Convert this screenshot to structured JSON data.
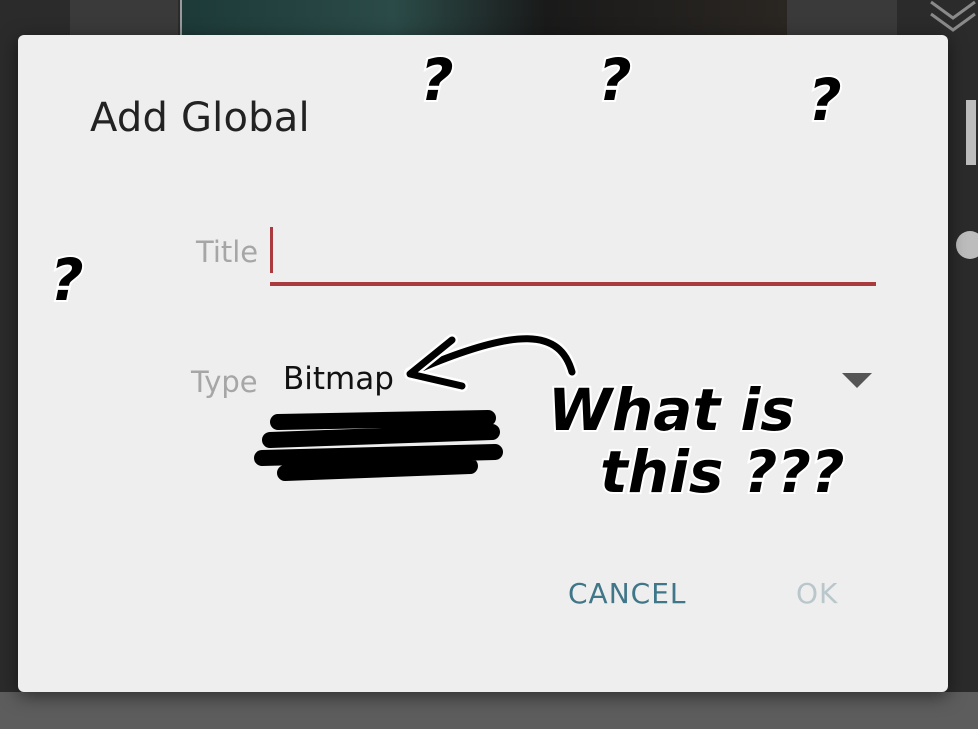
{
  "dialog": {
    "title": "Add Global",
    "title_field": {
      "label": "Title",
      "value": "",
      "placeholder": ""
    },
    "type_field": {
      "label": "Type",
      "selected": "Bitmap"
    },
    "buttons": {
      "cancel": "CANCEL",
      "ok": "OK"
    }
  },
  "annotation": {
    "line1": "What is",
    "line2": "this ???",
    "question_mark": "?"
  },
  "colors": {
    "accent_underline": "#a93a3e",
    "cancel_text": "#3f7688",
    "ok_disabled_text": "#b9c7cc",
    "dialog_bg": "#eeeeee",
    "label_text": "#a6a6a6"
  },
  "icons": {
    "background_top_right": "layers-icon",
    "dropdown": "triangle-down-icon"
  }
}
